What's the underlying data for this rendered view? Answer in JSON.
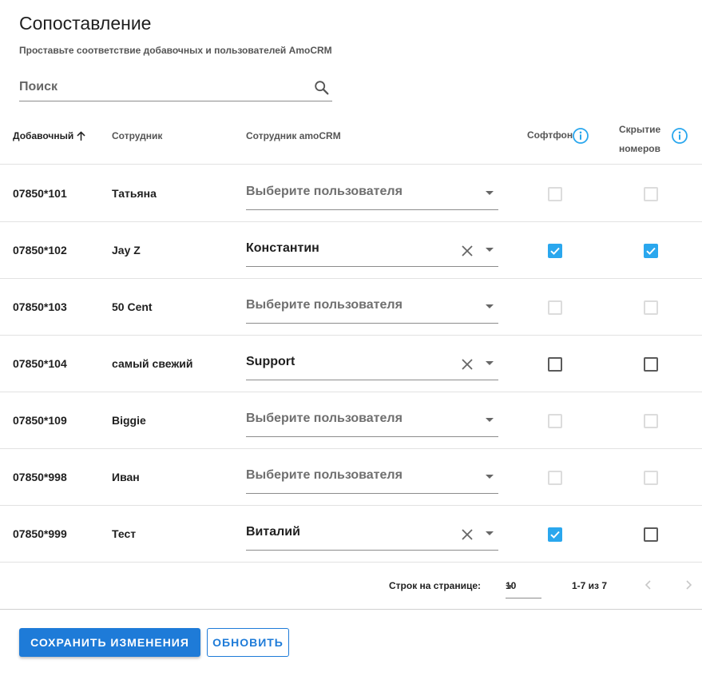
{
  "page": {
    "title": "Сопоставление",
    "subtitle": "Проставьте соответствие добавочных и пользователей AmoCRM"
  },
  "search": {
    "placeholder": "Поиск",
    "value": ""
  },
  "columns": {
    "extension": "Добавочный",
    "employee": "Сотрудник",
    "amo_employee": "Сотрудник amoCRM",
    "softphone": "Софтфон",
    "hide_line1": "Скрытие",
    "hide_line2": "номеров"
  },
  "select_placeholder": "Выберите пользователя",
  "rows": [
    {
      "extension": "07850*101",
      "employee": "Татьяна",
      "amo_user": "",
      "softphone": "disabled",
      "hide": "disabled"
    },
    {
      "extension": "07850*102",
      "employee": "Jay Z",
      "amo_user": "Константин",
      "softphone": "checked",
      "hide": "checked"
    },
    {
      "extension": "07850*103",
      "employee": "50 Cent",
      "amo_user": "",
      "softphone": "disabled",
      "hide": "disabled"
    },
    {
      "extension": "07850*104",
      "employee": "самый свежий",
      "amo_user": "Support",
      "softphone": "unchecked",
      "hide": "unchecked"
    },
    {
      "extension": "07850*109",
      "employee": "Biggie",
      "amo_user": "",
      "softphone": "disabled",
      "hide": "disabled"
    },
    {
      "extension": "07850*998",
      "employee": "Иван",
      "amo_user": "",
      "softphone": "disabled",
      "hide": "disabled"
    },
    {
      "extension": "07850*999",
      "employee": "Тест",
      "amo_user": "Виталий",
      "softphone": "checked",
      "hide": "unchecked"
    }
  ],
  "pagination": {
    "rows_per_page_label": "Строк на странице:",
    "rows_per_page": "10",
    "range": "1-7 из 7"
  },
  "buttons": {
    "save": "СОХРАНИТЬ ИЗМЕНЕНИЯ",
    "refresh": "ОБНОВИТЬ"
  },
  "colors": {
    "accent": "#1e7bd8",
    "checkbox_checked": "#2aa7ee",
    "info_icon": "#2aa7ee"
  }
}
